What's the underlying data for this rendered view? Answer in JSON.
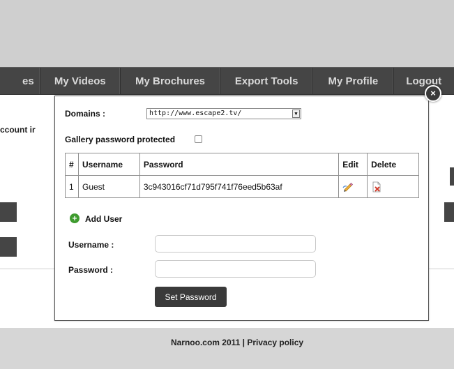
{
  "nav": {
    "items": [
      {
        "label": "es"
      },
      {
        "label": "My Videos"
      },
      {
        "label": "My Brochures"
      },
      {
        "label": "Export Tools"
      },
      {
        "label": "My Profile"
      },
      {
        "label": "Logout"
      }
    ]
  },
  "background": {
    "account_text": "ccount ir"
  },
  "modal": {
    "close_icon": "×",
    "domains_label": "Domains :",
    "domain_selected": "http://www.escape2.tv/",
    "gallery_password_label": "Gallery password protected",
    "gallery_password_checked": false,
    "table": {
      "headers": [
        "#",
        "Username",
        "Password",
        "Edit",
        "Delete"
      ],
      "rows": [
        {
          "num": "1",
          "username": "Guest",
          "password": "3c943016cf71d795f741f76eed5b63af",
          "edit_icon": "edit-icon",
          "delete_icon": "delete-icon"
        }
      ]
    },
    "add_user_label": "Add User",
    "username_label": "Username :",
    "password_label": "Password :",
    "username_value": "",
    "password_value": "",
    "set_password_label": "Set Password"
  },
  "footer": {
    "text": "Narnoo.com 2011 | Privacy policy"
  },
  "colors": {
    "nav_background": "#454545",
    "nav_text": "#d9d9d9",
    "top_band": "#cfcfcf",
    "footer_background": "#d6d6d6",
    "button_dark": "#3a3a3a",
    "add_icon_green": "#3f9b2f",
    "delete_icon_red": "#d23a2a"
  }
}
